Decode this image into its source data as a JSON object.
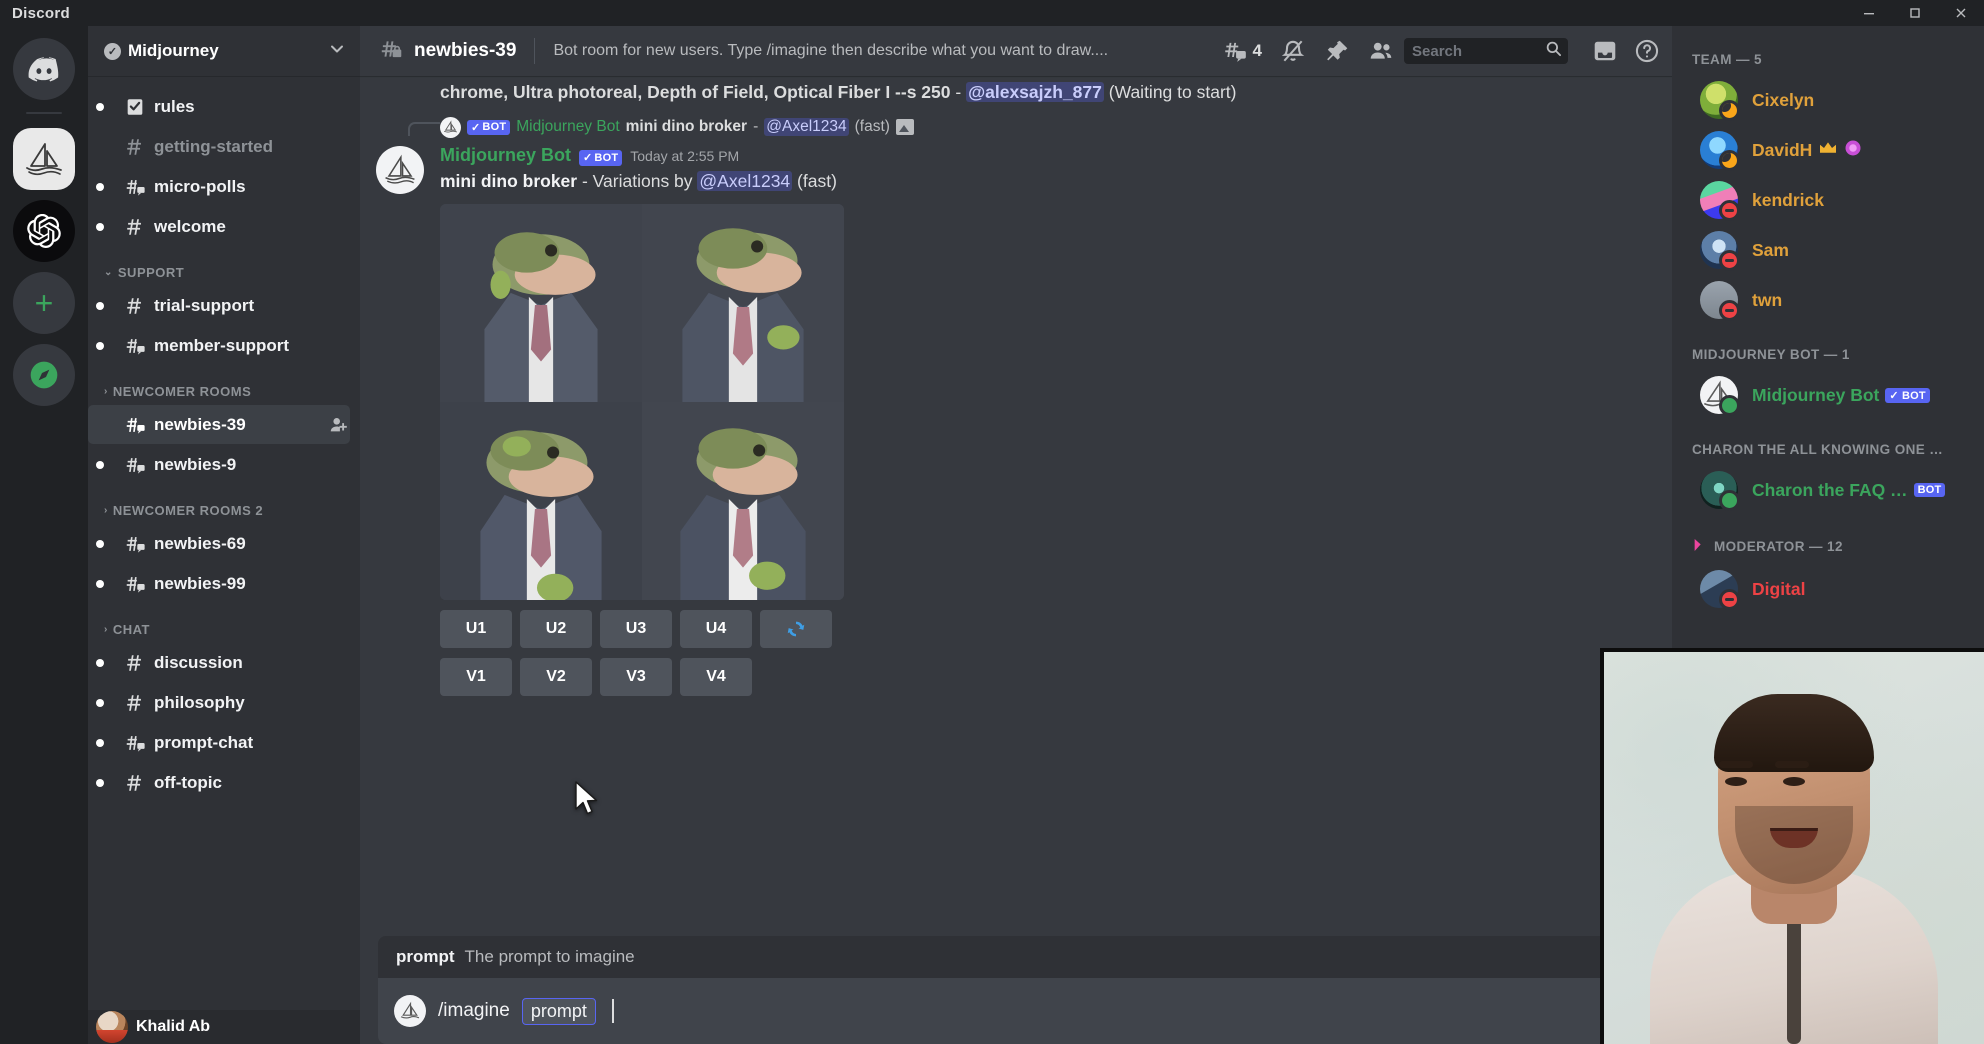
{
  "window": {
    "brand": "Discord",
    "minimize_label": "Minimize",
    "maximize_label": "Maximize",
    "close_label": "Close"
  },
  "server_rail": {
    "items": [
      {
        "name": "direct-messages",
        "icon": "discord-logo",
        "active": false,
        "unread": false
      },
      {
        "name": "midjourney-server",
        "icon": "midjourney-sailboat",
        "active": true,
        "unread": false
      },
      {
        "name": "openai-server",
        "icon": "openai-logo",
        "active": false,
        "unread": true
      },
      {
        "name": "add-server",
        "icon": "plus-icon",
        "active": false,
        "unread": false
      },
      {
        "name": "explore-servers",
        "icon": "compass-icon",
        "active": false,
        "unread": false
      }
    ]
  },
  "sidebar": {
    "guild_name": "Midjourney",
    "verified": true,
    "groups": [
      {
        "label": "",
        "channels": [
          {
            "name": "rules",
            "icon": "rules-icon",
            "unread": true,
            "selected": false
          },
          {
            "name": "getting-started",
            "icon": "hash-icon",
            "unread": false,
            "selected": false
          },
          {
            "name": "micro-polls",
            "icon": "hash-thread-icon",
            "unread": true,
            "selected": false
          },
          {
            "name": "welcome",
            "icon": "hash-icon",
            "unread": true,
            "selected": false
          }
        ]
      },
      {
        "label": "SUPPORT",
        "expanded": true,
        "channels": [
          {
            "name": "trial-support",
            "icon": "hash-icon",
            "unread": true,
            "selected": false
          },
          {
            "name": "member-support",
            "icon": "hash-thread-icon",
            "unread": true,
            "selected": false
          }
        ]
      },
      {
        "label": "NEWCOMER ROOMS",
        "expanded": false,
        "channels": [
          {
            "name": "newbies-39",
            "icon": "hash-thread-icon",
            "unread": false,
            "selected": true
          },
          {
            "name": "newbies-9",
            "icon": "hash-thread-icon",
            "unread": true,
            "selected": false
          }
        ]
      },
      {
        "label": "NEWCOMER ROOMS 2",
        "expanded": false,
        "channels": [
          {
            "name": "newbies-69",
            "icon": "hash-thread-icon",
            "unread": true,
            "selected": false
          },
          {
            "name": "newbies-99",
            "icon": "hash-thread-icon",
            "unread": true,
            "selected": false
          }
        ]
      },
      {
        "label": "CHAT",
        "expanded": false,
        "channels": [
          {
            "name": "discussion",
            "icon": "hash-icon",
            "unread": true,
            "selected": false
          },
          {
            "name": "philosophy",
            "icon": "hash-icon",
            "unread": true,
            "selected": false
          },
          {
            "name": "prompt-chat",
            "icon": "hash-thread-icon",
            "unread": true,
            "selected": false
          },
          {
            "name": "off-topic",
            "icon": "hash-icon",
            "unread": true,
            "selected": false
          }
        ]
      }
    ],
    "user": {
      "name": "Khalid Ab"
    }
  },
  "channel_header": {
    "channel_name": "newbies-39",
    "channel_icon": "hash-thread-locked-icon",
    "topic": "Bot room for new users. Type /imagine then describe what you want to draw....",
    "threads_count": "4",
    "icons": [
      "threads-icon",
      "notifications-muted-icon",
      "pinned-messages-icon",
      "member-list-icon"
    ],
    "search_placeholder": "Search",
    "right_icons": [
      "inbox-icon",
      "help-icon"
    ]
  },
  "messages": {
    "continued_text": {
      "before": "chrome, Ultra photoreal, Depth of Field, Optical Fiber I --s 250",
      "dash": " - ",
      "mention": "@alexsajzh_877",
      "after": " (Waiting to start)"
    },
    "reply_reference": {
      "bot_badge": "BOT",
      "bot_name": "Midjourney Bot",
      "prompt": "mini dino broker",
      "dash": " - ",
      "mention": "@Axel1234",
      "suffix": "(fast)"
    },
    "main": {
      "author": "Midjourney Bot",
      "bot_badge": "BOT",
      "timestamp": "Today at 2:55 PM",
      "prompt": "mini dino broker",
      "separator": " - ",
      "action": "Variations by",
      "mention": "@Axel1234",
      "suffix": "(fast)",
      "image_grid": [
        {
          "alt": "dinosaur in suit variation 1"
        },
        {
          "alt": "dinosaur in suit variation 2"
        },
        {
          "alt": "dinosaur in suit variation 3"
        },
        {
          "alt": "dinosaur in suit variation 4"
        }
      ],
      "upscale_buttons": [
        "U1",
        "U2",
        "U3",
        "U4"
      ],
      "reroll_icon": "refresh-icon",
      "variation_buttons": [
        "V1",
        "V2",
        "V3",
        "V4"
      ]
    }
  },
  "composer": {
    "suggestion_key": "prompt",
    "suggestion_desc": "The prompt to imagine",
    "command": "/imagine",
    "arg_chip": "prompt",
    "emoji_icon": "emoji-icon"
  },
  "members": {
    "sections": [
      {
        "label": "TEAM — 5",
        "icon": null,
        "people": [
          {
            "name": "Cixelyn",
            "color": "#e0a13b",
            "status": "idle",
            "badges": []
          },
          {
            "name": "DavidH",
            "color": "#e0a13b",
            "status": "idle",
            "badges": [
              "crown-icon",
              "gem-icon"
            ]
          },
          {
            "name": "kendrick",
            "color": "#e0a13b",
            "status": "dnd",
            "badges": []
          },
          {
            "name": "Sam",
            "color": "#e0a13b",
            "status": "dnd",
            "badges": []
          },
          {
            "name": "twn",
            "color": "#e0a13b",
            "status": "dnd",
            "badges": []
          }
        ]
      },
      {
        "label": "MIDJOURNEY BOT — 1",
        "icon": null,
        "people": [
          {
            "name": "Midjourney Bot",
            "color": "#3ba55d",
            "status": "online",
            "badges": [],
            "bot_tag": "BOT",
            "bot_verified": true
          }
        ]
      },
      {
        "label": "CHARON THE ALL KNOWING ONE …",
        "icon": null,
        "people": [
          {
            "name": "Charon the FAQ …",
            "color": "#3ba55d",
            "status": "online",
            "badges": [],
            "bot_tag": "BOT",
            "bot_verified": false
          }
        ]
      },
      {
        "label": "MODERATOR — 12",
        "icon": "moderator-icon",
        "people": [
          {
            "name": "Digital",
            "color": "#ed4245",
            "status": "dnd",
            "badges": []
          }
        ]
      }
    ]
  },
  "overlay": {
    "webcam_label": "webcam-overlay"
  },
  "colors": {
    "accent": "#5865f2",
    "online": "#3ba55d",
    "dnd": "#ed4245",
    "idle": "#faa61a",
    "bg_main": "#36393f",
    "bg_sidebar": "#2f3136",
    "bg_rail": "#202225"
  }
}
